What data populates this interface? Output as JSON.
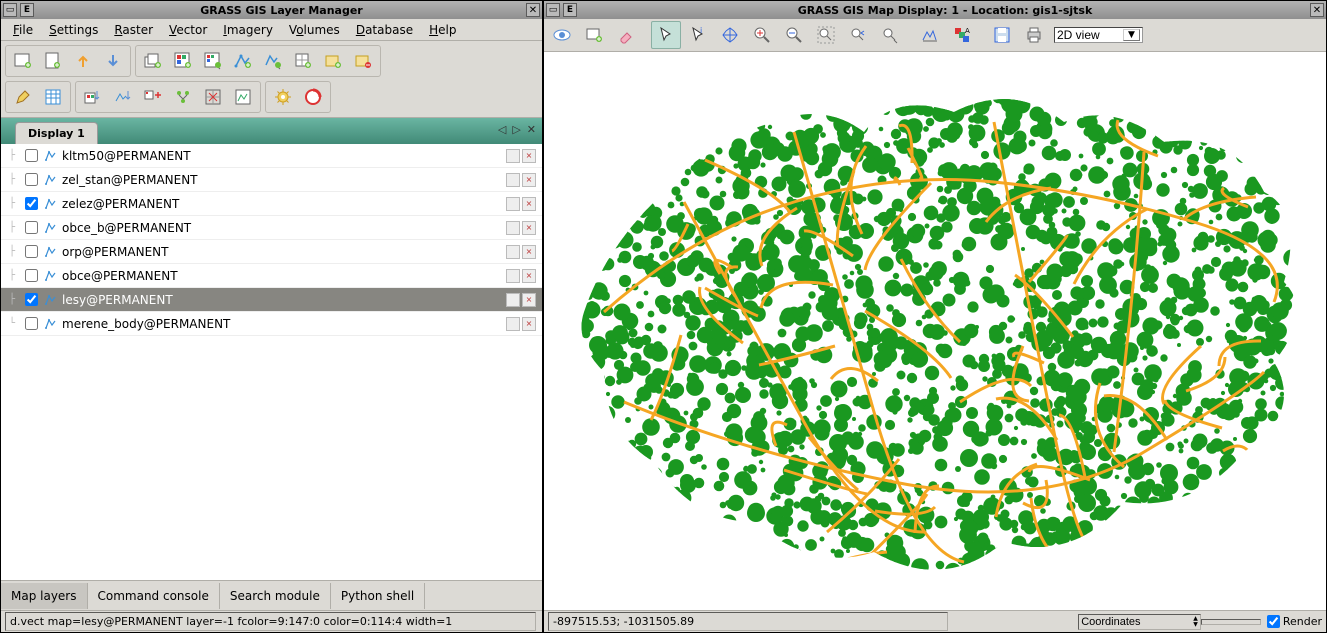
{
  "layerMgr": {
    "title": "GRASS GIS Layer Manager",
    "menu": [
      "File",
      "Settings",
      "Raster",
      "Vector",
      "Imagery",
      "Volumes",
      "Database",
      "Help"
    ],
    "displayTab": "Display 1",
    "layers": [
      {
        "name": "kltm50@PERMANENT",
        "checked": false,
        "selected": false
      },
      {
        "name": "zel_stan@PERMANENT",
        "checked": false,
        "selected": false
      },
      {
        "name": "zelez@PERMANENT",
        "checked": true,
        "selected": false
      },
      {
        "name": "obce_b@PERMANENT",
        "checked": false,
        "selected": false
      },
      {
        "name": "orp@PERMANENT",
        "checked": false,
        "selected": false
      },
      {
        "name": "obce@PERMANENT",
        "checked": false,
        "selected": false
      },
      {
        "name": "lesy@PERMANENT",
        "checked": true,
        "selected": true
      },
      {
        "name": "merene_body@PERMANENT",
        "checked": false,
        "selected": false
      }
    ],
    "bottomTabs": [
      "Map layers",
      "Command console",
      "Search module",
      "Python shell"
    ],
    "status": "d.vect map=lesy@PERMANENT layer=-1 fcolor=9:147:0 color=0:114:4 width=1"
  },
  "mapDisp": {
    "title": "GRASS GIS Map Display: 1  - Location: gis1-sjtsk",
    "viewMode": "2D view",
    "coords": "-897515.53; -1031505.89",
    "statusMode": "Coordinates",
    "renderLabel": "Render"
  }
}
